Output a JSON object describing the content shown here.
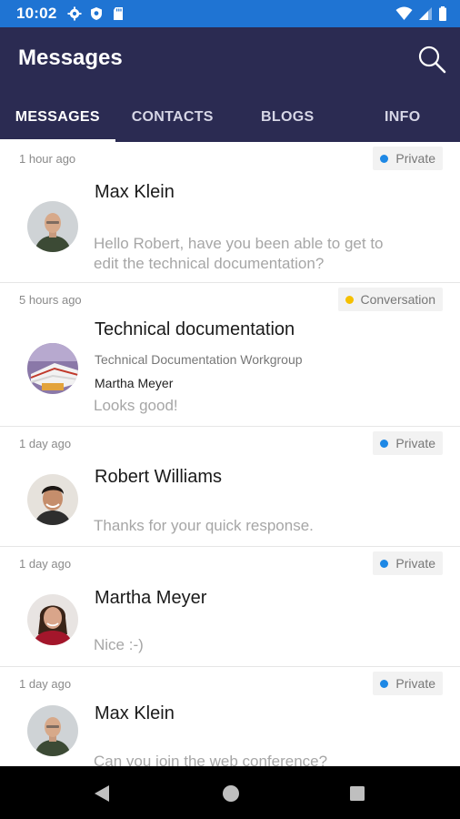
{
  "status_bar": {
    "time": "10:02",
    "icons_left": [
      "gear-icon",
      "shield-icon",
      "sd-card-icon"
    ],
    "icons_right": [
      "wifi-icon",
      "signal-icon",
      "battery-icon"
    ]
  },
  "app_bar": {
    "title": "Messages",
    "background": "#2b2b52",
    "tabs": [
      {
        "label": "MESSAGES",
        "active": true
      },
      {
        "label": "CONTACTS",
        "active": false
      },
      {
        "label": "BLOGS",
        "active": false
      },
      {
        "label": "INFO",
        "active": false
      }
    ]
  },
  "colors": {
    "status_bar": "#1f74d3",
    "private_dot": "#1e88e5",
    "conversation_dot": "#f5c000"
  },
  "messages": [
    {
      "time": "1 hour ago",
      "badge": "Private",
      "name": "Max Klein",
      "preview": "Hello Robert, have you been able to get to edit the technical documentation?",
      "avatar": "bald-man-avatar"
    },
    {
      "time": "5 hours ago",
      "badge": "Conversation",
      "name": "Technical documentation",
      "group": "Technical Documentation Workgroup",
      "sender": "Martha Meyer",
      "preview": "Looks good!",
      "avatar": "documents-avatar"
    },
    {
      "time": "1 day ago",
      "badge": "Private",
      "name": "Robert Williams",
      "preview": "Thanks for your quick response.",
      "avatar": "dark-hair-man-avatar"
    },
    {
      "time": "1 day ago",
      "badge": "Private",
      "name": "Martha Meyer",
      "preview": "Nice :-)",
      "avatar": "woman-avatar"
    },
    {
      "time": "1 day ago",
      "badge": "Private",
      "name": "Max Klein",
      "preview": "Can you join the web conference?",
      "avatar": "bald-man-avatar"
    }
  ],
  "nav_bar": {
    "icons": [
      "back-icon",
      "home-icon",
      "recents-icon"
    ]
  }
}
